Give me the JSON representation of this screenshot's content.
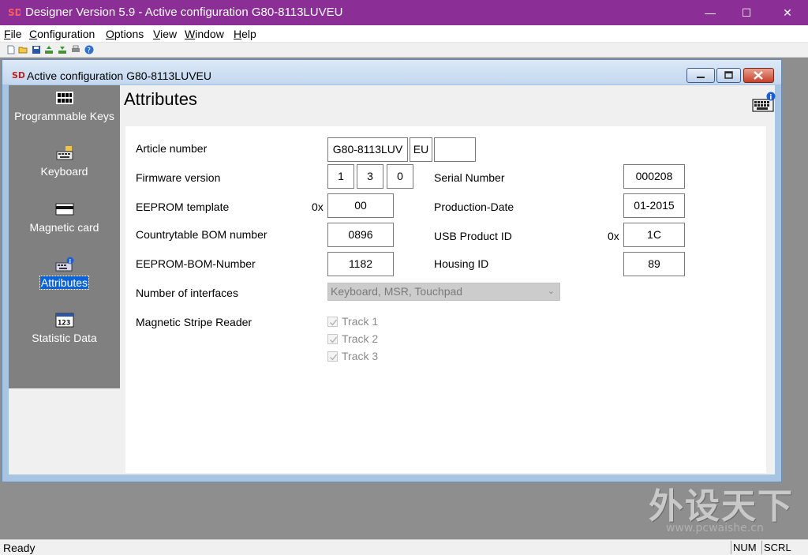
{
  "window": {
    "title": "Designer Version 5.9 - Active configuration G80-8113LUVEU",
    "minimize_glyph": "—",
    "maximize_glyph": "☐",
    "close_glyph": "✕"
  },
  "menubar": {
    "items": [
      {
        "accel": "F",
        "rest": "ile"
      },
      {
        "accel": "C",
        "rest": "onfiguration"
      },
      {
        "accel": "O",
        "rest": "ptions"
      },
      {
        "accel": "V",
        "rest": "iew"
      },
      {
        "accel": "W",
        "rest": "indow"
      },
      {
        "accel": "H",
        "rest": "elp"
      }
    ]
  },
  "toolbar": {
    "icons": [
      "new-file-icon",
      "open-folder-icon",
      "save-icon",
      "upload-icon",
      "download-icon",
      "print-icon",
      "help-icon"
    ]
  },
  "child_window": {
    "title": "Active configuration G80-8113LUVEU"
  },
  "sidebar": {
    "items": [
      {
        "label": "Programmable Keys",
        "icon": "programmable-keys-icon"
      },
      {
        "label": "Keyboard",
        "icon": "keyboard-icon"
      },
      {
        "label": "Magnetic card",
        "icon": "magnetic-card-icon"
      },
      {
        "label": "Attributes",
        "icon": "attributes-icon",
        "active": true
      },
      {
        "label": "Statistic Data",
        "icon": "statistic-data-icon",
        "icon_text": "123"
      }
    ]
  },
  "page": {
    "heading": "Attributes"
  },
  "form": {
    "article_number": {
      "label": "Article number",
      "part1": "G80-8113LUV",
      "part2": "EU",
      "part3": ""
    },
    "firmware_version": {
      "label": "Firmware version",
      "major": "1",
      "minor": "3",
      "patch": "0"
    },
    "eeprom_template": {
      "label": "EEPROM template",
      "prefix": "0x",
      "value": "00"
    },
    "countrytable_bom": {
      "label": "Countrytable BOM number",
      "value": "0896"
    },
    "eeprom_bom": {
      "label": "EEPROM-BOM-Number",
      "value": "1182"
    },
    "number_of_interfaces": {
      "label": "Number of interfaces",
      "value": "Keyboard, MSR, Touchpad"
    },
    "msr": {
      "label": "Magnetic Stripe Reader",
      "tracks": [
        {
          "label": "Track 1",
          "checked": true
        },
        {
          "label": "Track 2",
          "checked": true
        },
        {
          "label": "Track 3",
          "checked": true
        }
      ]
    },
    "serial_number": {
      "label": "Serial Number",
      "value": "000208"
    },
    "production_date": {
      "label": "Production-Date",
      "value": "01-2015"
    },
    "usb_product_id": {
      "label": "USB Product ID",
      "prefix": "0x",
      "value": "1C"
    },
    "housing_id": {
      "label": "Housing ID",
      "value": "89"
    }
  },
  "statusbar": {
    "text": "Ready",
    "num": "NUM",
    "scrl": "SCRL"
  },
  "watermark": {
    "big": "外设天下",
    "url": "www.pcwaishe.cn"
  }
}
